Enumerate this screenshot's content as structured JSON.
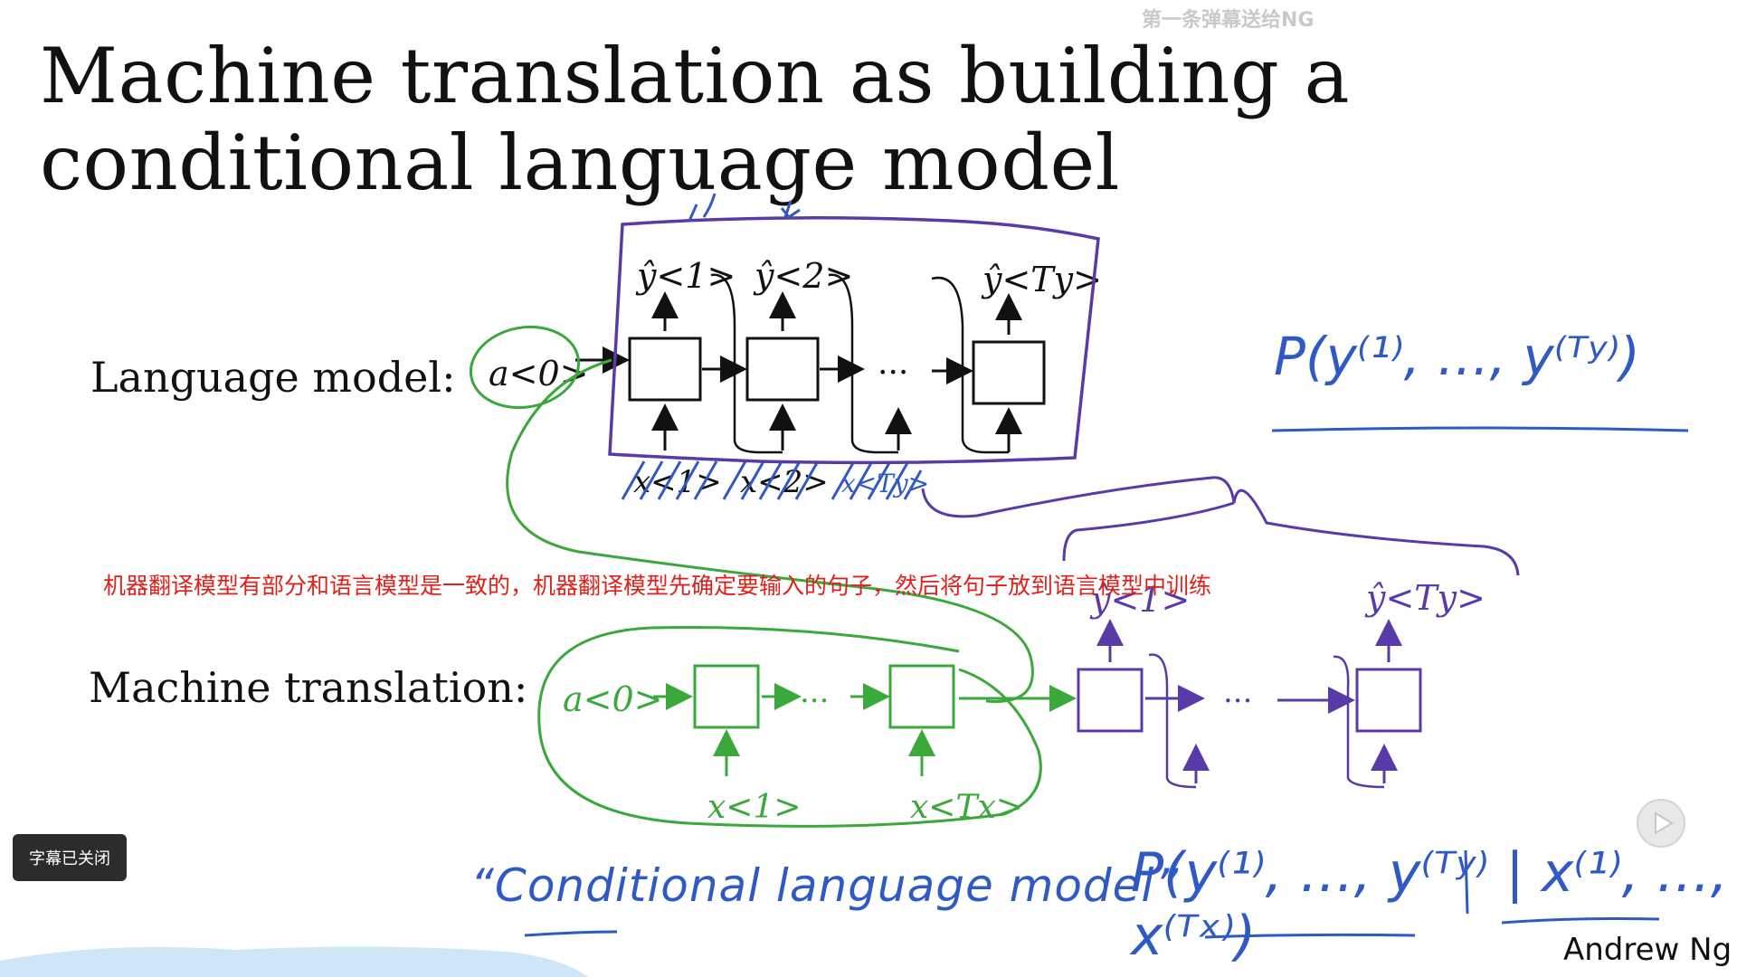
{
  "slide": {
    "title": "Machine translation as building a conditional language model",
    "language_model_label": "Language model:",
    "machine_translation_label": "Machine translation:",
    "author": "Andrew Ng"
  },
  "annotations": {
    "lm_probability": "P(y⁽¹⁾, …, y⁽ᵀʸ⁾)",
    "mt_probability": "P(y⁽¹⁾, …, y⁽ᵀʸ⁾ | x⁽¹⁾, …, x⁽ᵀˣ⁾)",
    "conditional_lm": "“Conditional language model”"
  },
  "overlay": {
    "danmaku": "第一条弹幕送给NG",
    "subtitle": "机器翻译模型有部分和语言模型是一致的，机器翻译模型先确定要输入的句子，然后将句子放到语言模型中训练",
    "caption_toggle": "字幕已关闭",
    "play_icon": "play-icon"
  },
  "diagram": {
    "lm_a0": "a<0>",
    "lm_outputs": [
      "ŷ<1>",
      "ŷ<2>",
      "ŷ<Ty>"
    ],
    "lm_inputs": [
      "x<1>",
      "x<2>",
      "x<Ty>"
    ],
    "lm_dots": "···",
    "mt_a0": "a<0>",
    "mt_inputs": [
      "x<1>",
      "x<Tx>"
    ],
    "mt_outputs": [
      "ŷ<1>",
      "ŷ<Ty>"
    ],
    "mt_enc_dots": "···",
    "mt_dec_dots": "···"
  },
  "colors": {
    "black": "#111111",
    "green": "#3aa83a",
    "purple": "#5a3aa8",
    "blue_ink": "#2f59c5",
    "subtitle_red": "#e0201a"
  }
}
